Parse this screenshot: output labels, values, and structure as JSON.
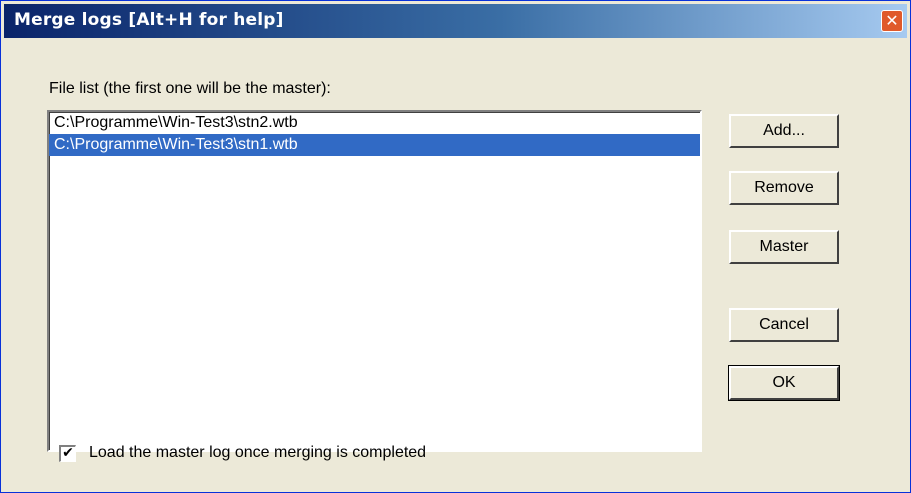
{
  "window": {
    "title": "Merge logs [Alt+H for help]",
    "close_glyph": "✕"
  },
  "file_list": {
    "label": "File list (the first one will be the master):",
    "items": [
      {
        "path": "C:\\Programme\\Win-Test3\\stn2.wtb",
        "selected": false
      },
      {
        "path": "C:\\Programme\\Win-Test3\\stn1.wtb",
        "selected": true
      }
    ]
  },
  "buttons": {
    "add": "Add...",
    "remove": "Remove",
    "master": "Master",
    "cancel": "Cancel",
    "ok": "OK"
  },
  "options": {
    "load_master_label": "Load the master log once merging is completed",
    "load_master_checked": true,
    "check_glyph": "✔"
  },
  "colors": {
    "title_bar_start": "#0a246a",
    "selection": "#316ac5",
    "close_button": "#e05a2b"
  }
}
